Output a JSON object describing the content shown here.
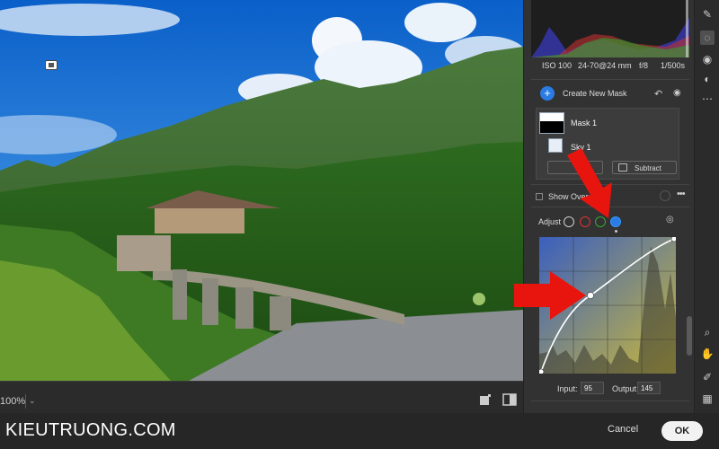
{
  "canvas": {
    "zoom": "100%",
    "zoom_caret": "⌄"
  },
  "footer": {
    "brand": "KIEUTRUONG.COM",
    "cancel_label": "Cancel",
    "ok_label": "OK"
  },
  "camera": {
    "iso": "ISO 100",
    "lens": "24-70@24 mm",
    "aperture": "f/8",
    "shutter": "1/500s"
  },
  "mask_panel": {
    "create_label": "Create New Mask",
    "mask_name": "Mask 1",
    "sky_name": "Sky 1",
    "subtract_label": "Subtract",
    "show_overlay_label": "Show Over",
    "more_glyph": "•••"
  },
  "adjust": {
    "label": "Adjust",
    "channels": [
      "all",
      "red",
      "green",
      "blue"
    ],
    "selected_channel": "blue",
    "input_label": "Input:",
    "input_value": "95",
    "output_label": "Output:",
    "output_value": "145"
  },
  "colors": {
    "accent": "#2a7be4",
    "arrow": "#e8150f",
    "ok_button": "#f2f2f2"
  },
  "icons": {
    "tools": [
      "brush-icon",
      "mask-icon",
      "redeye-icon",
      "presets-icon",
      "more-icon",
      "zoom-icon",
      "hand-icon",
      "eyedropper-icon",
      "grid-icon"
    ]
  }
}
